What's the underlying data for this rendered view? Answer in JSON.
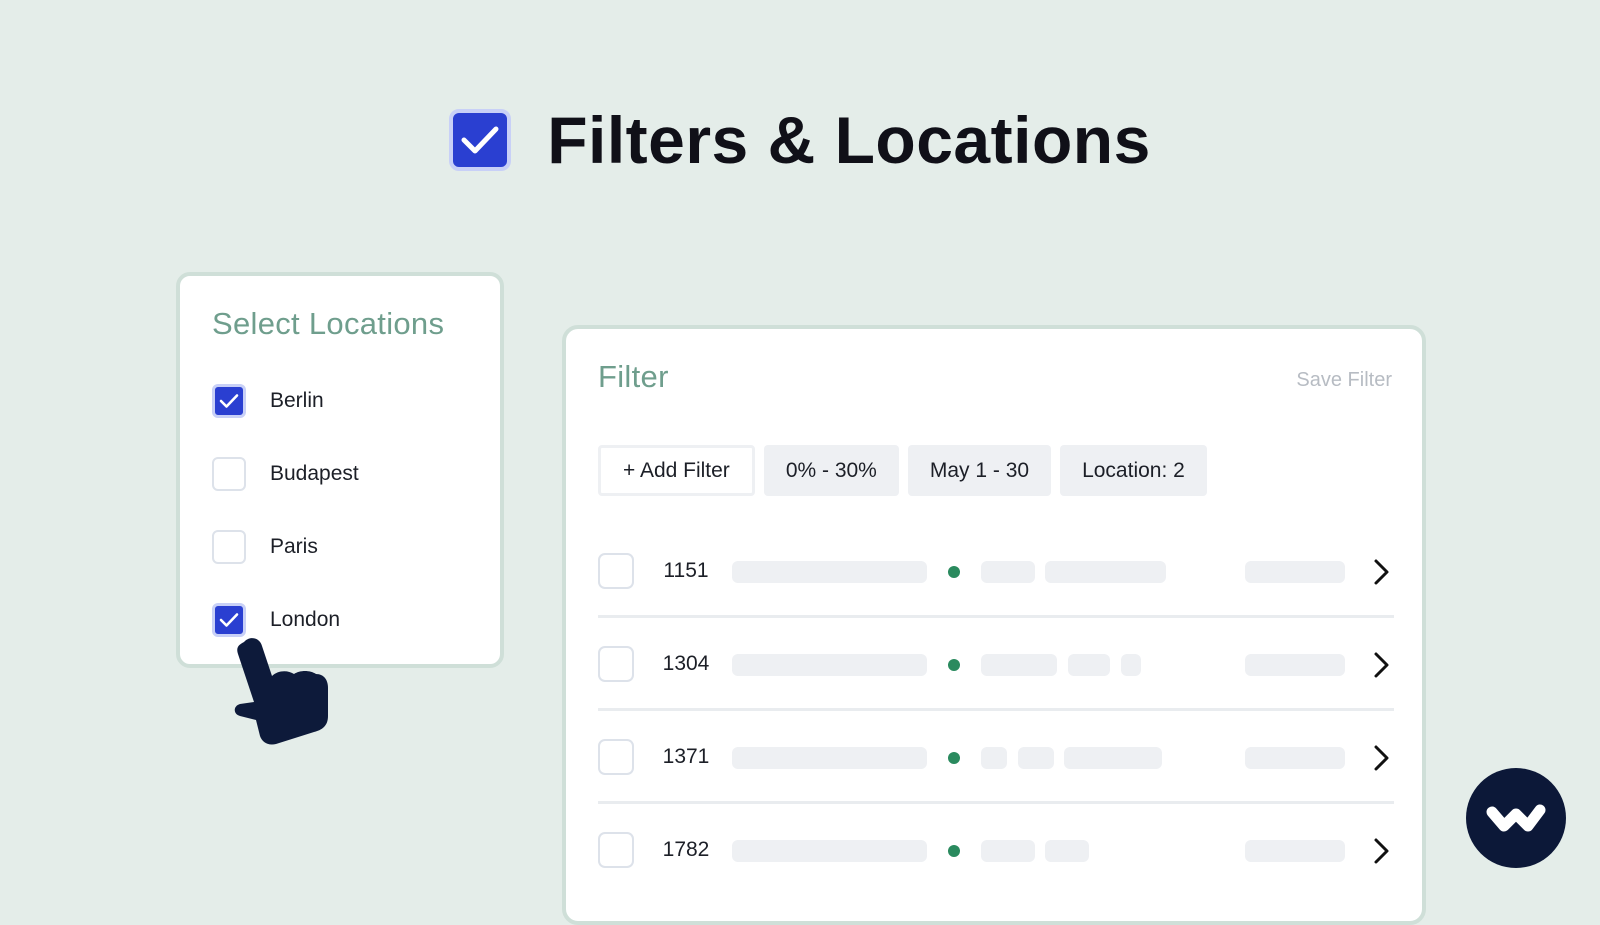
{
  "hero": {
    "title": "Filters & Locations",
    "icon": "checkbox-checked-icon"
  },
  "locations": {
    "title": "Select Locations",
    "items": [
      {
        "label": "Berlin",
        "checked": true
      },
      {
        "label": "Budapest",
        "checked": false
      },
      {
        "label": "Paris",
        "checked": false
      },
      {
        "label": "London",
        "checked": true
      }
    ]
  },
  "filter": {
    "title": "Filter",
    "save_label": "Save Filter",
    "chips": {
      "add": "+ Add Filter",
      "range": "0% - 30%",
      "dates": "May 1 - 30",
      "location": "Location: 2"
    },
    "rows": [
      {
        "id": "1151"
      },
      {
        "id": "1304"
      },
      {
        "id": "1371"
      },
      {
        "id": "1782"
      }
    ]
  },
  "colors": {
    "background": "#e4ede9",
    "accent_blue": "#2a3fd1",
    "heading_green": "#6f9e8d",
    "status_dot": "#2a8a5e",
    "logo_navy": "#0c1838"
  }
}
